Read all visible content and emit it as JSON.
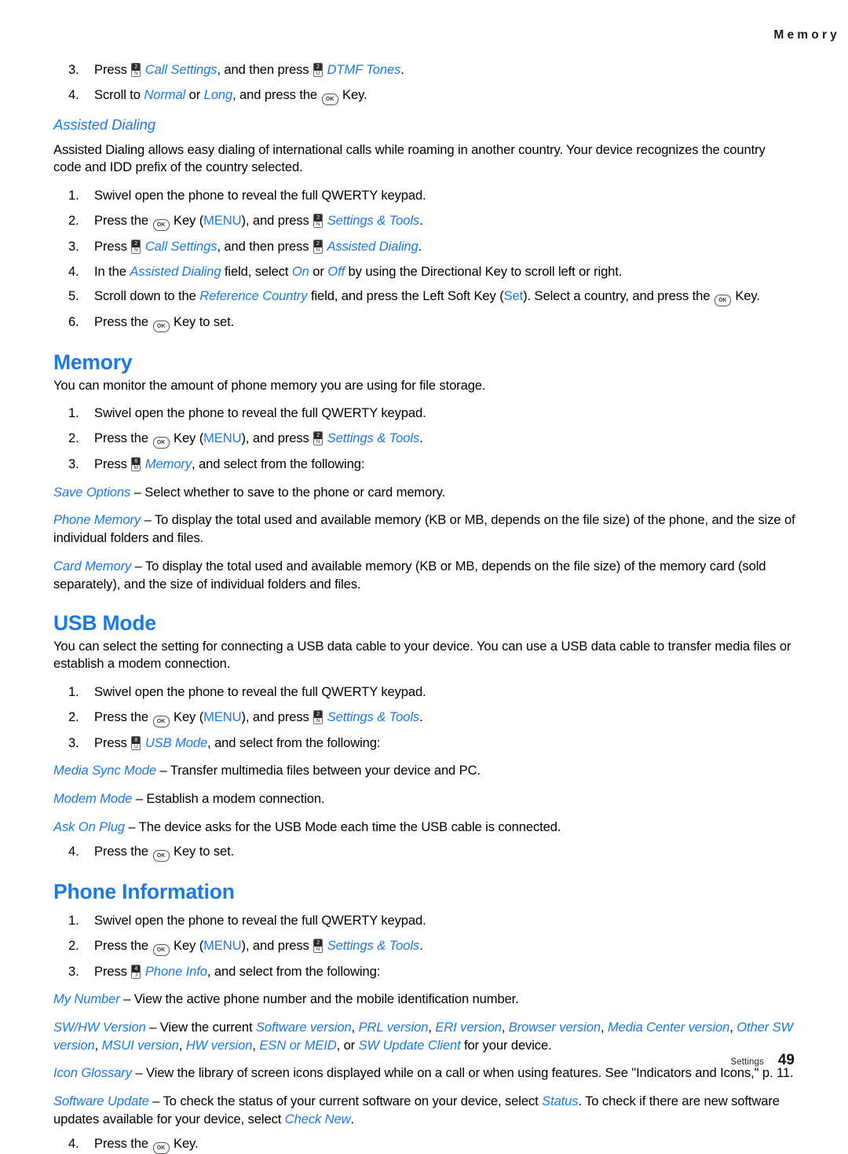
{
  "header": {
    "running_title": "Memory"
  },
  "footer": {
    "chapter": "Settings",
    "page_number": "49"
  },
  "colors": {
    "link_blue": "#1a7ae8",
    "body_text": "#000000"
  },
  "icons": {
    "ok_key": {
      "label": "OK",
      "name": "ok-key-icon"
    },
    "key_2n": {
      "digit": "2",
      "letter": "N"
    },
    "key_6m": {
      "digit": "6",
      "letter": "M"
    },
    "key_8u": {
      "digit": "8",
      "letter": "U"
    },
    "key_4j": {
      "digit": "4",
      "letter": "J"
    }
  },
  "top_steps": {
    "step3": {
      "num": "3.",
      "t1": "Press ",
      "link1": "Call Settings",
      "t2": ", and then press ",
      "link2": "DTMF Tones",
      "t3": "."
    },
    "step4": {
      "num": "4.",
      "t1": "Scroll to ",
      "link1": "Normal",
      "t2": " or ",
      "link2": "Long",
      "t3": ", and press the ",
      "t4": " Key."
    }
  },
  "assisted_dialing": {
    "heading": "Assisted Dialing",
    "intro": "Assisted Dialing allows easy dialing of international calls while roaming in another country. Your device recognizes the country code and IDD prefix of the country selected.",
    "steps": [
      {
        "num": "1.",
        "text": "Swivel open the phone to reveal the full QWERTY keypad."
      },
      {
        "num": "2.",
        "t1": "Press the ",
        "t2": " Key (",
        "link1": "MENU",
        "t3": "), and press ",
        "link2": "Settings & Tools",
        "t4": "."
      },
      {
        "num": "3.",
        "t1": "Press ",
        "link1": "Call Settings",
        "t2": ", and then press ",
        "link2": "Assisted Dialing",
        "t3": "."
      },
      {
        "num": "4.",
        "t1": "In the ",
        "link1": "Assisted Dialing",
        "t2": " field, select ",
        "link2": "On",
        "t3": " or ",
        "link3": "Off",
        "t4": " by using the Directional Key to scroll left or right."
      },
      {
        "num": "5.",
        "t1": "Scroll down to the ",
        "link1": "Reference Country",
        "t2": " field, and press the Left Soft Key (",
        "link2": "Set",
        "t3": "). Select a country, and press the ",
        "t4": " Key."
      },
      {
        "num": "6.",
        "t1": "Press the ",
        "t2": " Key to set."
      }
    ]
  },
  "memory": {
    "heading": "Memory",
    "intro": "You can monitor the amount of phone memory you are using for file storage.",
    "steps": [
      {
        "num": "1.",
        "text": "Swivel open the phone to reveal the full QWERTY keypad."
      },
      {
        "num": "2.",
        "t1": "Press the ",
        "t2": " Key (",
        "link1": "MENU",
        "t3": "), and press ",
        "link2": "Settings & Tools",
        "t4": "."
      },
      {
        "num": "3.",
        "t1": "Press ",
        "link1": "Memory",
        "t2": ", and select from the following:"
      }
    ],
    "options": [
      {
        "term": "Save Options",
        "dash": " – ",
        "desc": "Select whether to save to the phone or card memory."
      },
      {
        "term": "Phone Memory",
        "dash": " – ",
        "desc": "To display the total used and available memory (KB or MB, depends on the file size) of the phone, and the size of individual folders and files."
      },
      {
        "term": "Card Memory",
        "dash": " – ",
        "desc": "To display the total used and available memory (KB or MB, depends on the file size) of the memory card (sold separately), and the size of individual folders and files."
      }
    ]
  },
  "usb_mode": {
    "heading": "USB Mode",
    "intro": "You can select the setting for connecting a USB data cable to your device. You can use a USB data cable to transfer media files or establish a modem connection.",
    "steps": [
      {
        "num": "1.",
        "text": "Swivel open the phone to reveal the full QWERTY keypad."
      },
      {
        "num": "2.",
        "t1": "Press the ",
        "t2": " Key (",
        "link1": "MENU",
        "t3": "), and press ",
        "link2": "Settings & Tools",
        "t4": "."
      },
      {
        "num": "3.",
        "t1": "Press ",
        "link1": "USB Mode",
        "t2": ", and select from the following:"
      }
    ],
    "options": [
      {
        "term": "Media Sync Mode",
        "dash": " – ",
        "desc": "Transfer multimedia files between your device and PC."
      },
      {
        "term": "Modem Mode",
        "dash": " – ",
        "desc": "Establish a modem connection."
      },
      {
        "term": "Ask On Plug",
        "dash": " – ",
        "desc": "The device asks for the USB Mode each time the USB cable is connected."
      }
    ],
    "final_step": {
      "num": "4.",
      "t1": "Press the ",
      "t2": " Key to set."
    }
  },
  "phone_information": {
    "heading": "Phone Information",
    "steps": [
      {
        "num": "1.",
        "text": "Swivel open the phone to reveal the full QWERTY keypad."
      },
      {
        "num": "2.",
        "t1": "Press the ",
        "t2": " Key (",
        "link1": "MENU",
        "t3": "), and press ",
        "link2": "Settings & Tools",
        "t4": "."
      },
      {
        "num": "3.",
        "t1": "Press ",
        "link1": "Phone Info",
        "t2": ", and select from the following:"
      }
    ],
    "options": {
      "my_number": {
        "term": "My Number",
        "dash": " – ",
        "desc": "View the active phone number and the mobile identification number."
      },
      "sw_hw": {
        "term": "SW/HW Version",
        "dash": " – ",
        "t1": "View the current ",
        "links": [
          "Software version",
          "PRL version",
          "ERI version",
          "Browser version",
          "Media Center version",
          "Other SW version",
          "MSUI version",
          "HW version",
          "ESN or MEID",
          "SW Update Client"
        ],
        "t2": " for your device."
      },
      "icon_glossary": {
        "term": "Icon Glossary",
        "dash": " – ",
        "desc": "View the library of screen icons displayed while on a call or when using features. See \"Indicators and Icons,\" p. 11."
      },
      "software_update": {
        "term": "Software Update",
        "dash": " – ",
        "t1": "To check the status of your current software on your device, select ",
        "link1": "Status",
        "t2": ". To check if there are new software updates available for your device, select ",
        "link2": "Check New",
        "t3": "."
      }
    },
    "final_step": {
      "num": "4.",
      "t1": "Press the ",
      "t2": " Key."
    }
  }
}
